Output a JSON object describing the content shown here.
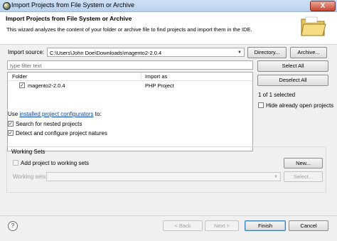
{
  "window": {
    "title": "Import Projects from File System or Archive",
    "close_label": "X"
  },
  "header": {
    "title": "Import Projects from File System or Archive",
    "description": "This wizard analyzes the content of your folder or archive file to find projects and import them in the IDE."
  },
  "source": {
    "label": "Import source:",
    "value": "C:\\Users\\John Doe\\Downloads\\magento2-2.0.4",
    "directory_button": "Directory...",
    "archive_button": "Archive..."
  },
  "filter": {
    "placeholder": "type filter text"
  },
  "table": {
    "columns": [
      "Folder",
      "Import as"
    ],
    "rows": [
      {
        "checked": true,
        "folder": "magento2-2.0.4",
        "import_as": "PHP Project"
      }
    ]
  },
  "side": {
    "select_all": "Select All",
    "deselect_all": "Deselect All",
    "selected_count": "1 of 1 selected",
    "hide_open": "Hide already open projects"
  },
  "options": {
    "use_prefix": "Use",
    "configurators_link": "installed project configurators",
    "use_suffix": "to:",
    "search_nested": "Search for nested projects",
    "detect_configure": "Detect and configure project natures"
  },
  "working_sets": {
    "title": "Working Sets",
    "add_label": "Add project to working sets",
    "new_button": "New...",
    "sets_label": "Working sets:",
    "select_button": "Select..."
  },
  "footer": {
    "help_label": "?",
    "back_button": "< Back",
    "next_button": "Next >",
    "finish_button": "Finish",
    "cancel_button": "Cancel"
  }
}
